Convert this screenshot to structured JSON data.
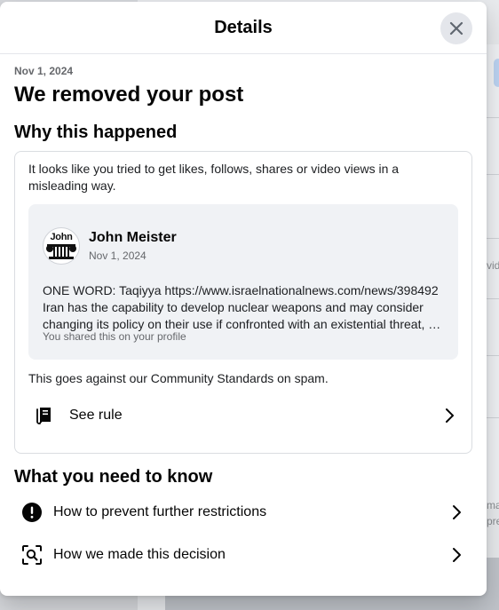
{
  "modal": {
    "title": "Details",
    "close_icon": "close-icon"
  },
  "notice": {
    "date": "Nov 1, 2024",
    "headline": "We removed your post"
  },
  "why": {
    "title": "Why this happened",
    "reason": "It looks like you tried to get likes, follows, shares or video views in a misleading way.",
    "post": {
      "author": "John Meister",
      "date": "Nov 1, 2024",
      "avatar_text": "John",
      "lines": [
        "ONE WORD: Taqiyya https://www.israelnationalnews.com/news/398492",
        "Iran has the capability to develop nuclear weapons and may consider",
        "changing its policy on their use if confronted with an existential threat, …"
      ],
      "footnote": "You shared this on your profile"
    },
    "standards": "This goes against our Community Standards on spam.",
    "see_rule": "See rule",
    "see_rule_icon": "rulebook-icon"
  },
  "know": {
    "title": "What you need to know",
    "items": [
      {
        "label": "How to prevent further restrictions",
        "icon": "alert-icon"
      },
      {
        "label": "How we made this decision",
        "icon": "magnify-scan-icon"
      }
    ]
  },
  "background": {
    "side_text_1": "vid",
    "side_text_2": "ma",
    "side_text_3": "pre"
  }
}
